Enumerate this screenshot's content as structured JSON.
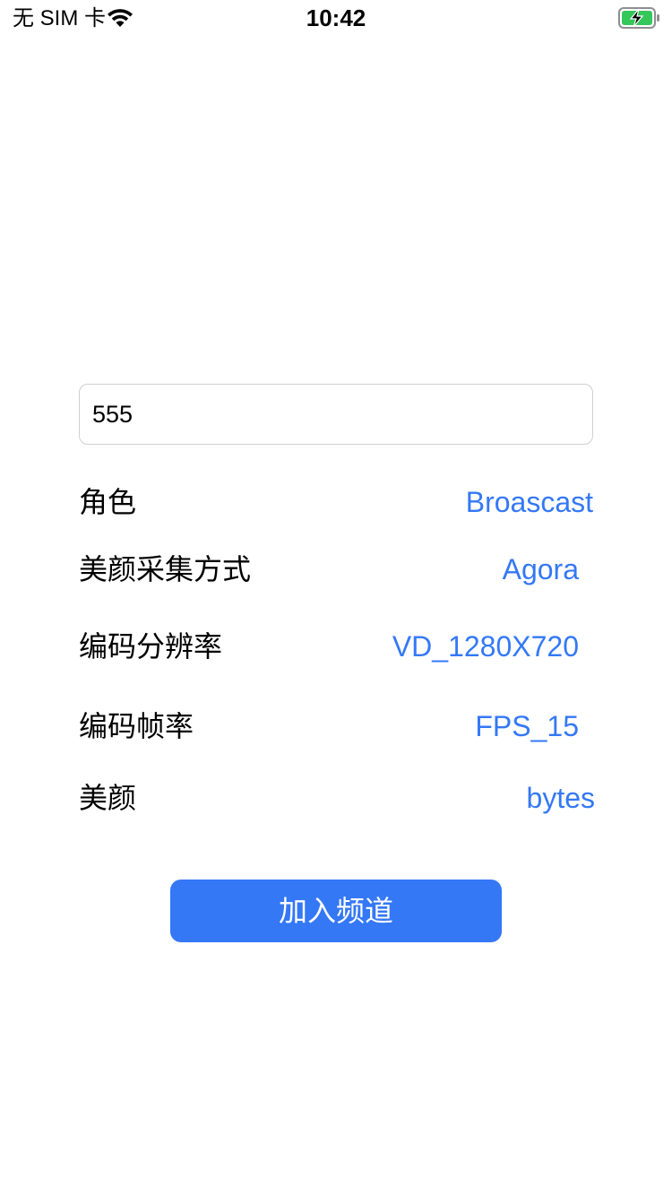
{
  "status_bar": {
    "carrier": "无 SIM 卡",
    "time": "10:42",
    "wifi_icon": "wifi-icon",
    "battery_icon": "battery-charging-icon",
    "battery_color": "#34c759"
  },
  "channel_input": {
    "value": "555"
  },
  "settings": {
    "role": {
      "label": "角色",
      "value": "Broascast"
    },
    "beauty_capture": {
      "label": "美颜采集方式",
      "value": "Agora"
    },
    "resolution": {
      "label": "编码分辨率",
      "value": "VD_1280X720"
    },
    "framerate": {
      "label": "编码帧率",
      "value": "FPS_15"
    },
    "beauty": {
      "label": "美颜",
      "value": "bytes"
    }
  },
  "join_button": {
    "label": "加入频道"
  },
  "colors": {
    "accent": "#3478f6",
    "background": "#ffffff",
    "text": "#000000"
  }
}
